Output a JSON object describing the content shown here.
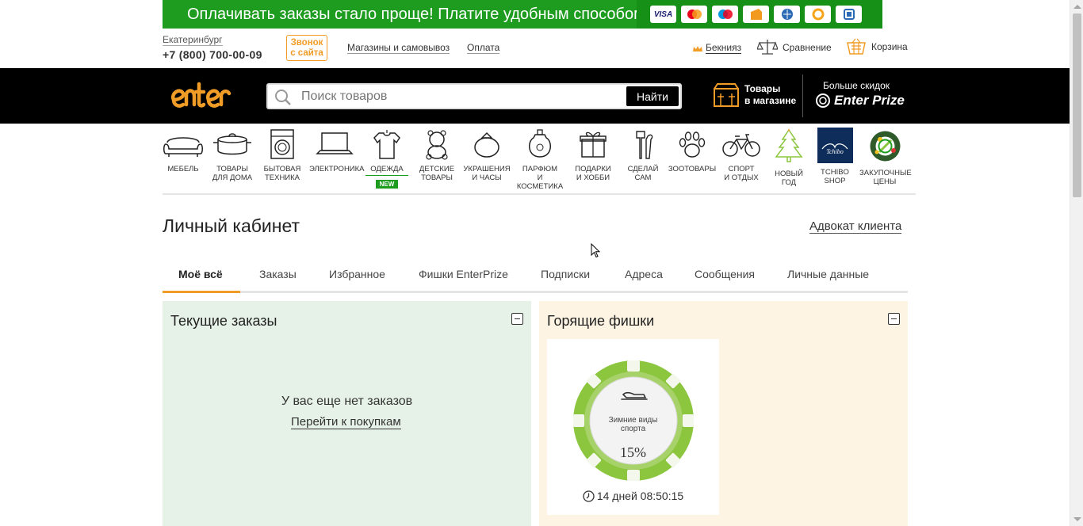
{
  "promo": {
    "text": "Оплачивать заказы стало проще! Платите удобным способом",
    "cards": [
      "VISA",
      "MasterCard",
      "Maestro",
      "Яндекс.Деньги",
      "WebMoney",
      "QIWI",
      "Платёжный терминал"
    ]
  },
  "topbar": {
    "city": "Екатеринбург",
    "phone": "+7 (800) 700-00-09",
    "callback_line1": "Звонок",
    "callback_line2": "с сайта",
    "stores_link": "Магазины и самовывоз",
    "payment_link": "Оплата",
    "user_name": "Бекнияз",
    "compare_label": "Сравнение",
    "cart_label": "Корзина"
  },
  "header": {
    "search_placeholder": "Поиск товаров",
    "search_button": "Найти",
    "store_line1": "Товары",
    "store_line2": "в магазине",
    "prize_top": "Больше скидок",
    "prize_name": "Enter Prize"
  },
  "categories": [
    {
      "line1": "Мебель",
      "line2": ""
    },
    {
      "line1": "Товары",
      "line2": "для дома"
    },
    {
      "line1": "Бытовая",
      "line2": "техника"
    },
    {
      "line1": "Электроника",
      "line2": ""
    },
    {
      "line1": "Одежда",
      "line2": "",
      "badge": "NEW"
    },
    {
      "line1": "Детские",
      "line2": "товары"
    },
    {
      "line1": "Украшения",
      "line2": "и часы"
    },
    {
      "line1": "Парфюм",
      "line2": "и косметика"
    },
    {
      "line1": "Подарки",
      "line2": "и хобби"
    },
    {
      "line1": "Сделай",
      "line2": "сам"
    },
    {
      "line1": "Зоотовары",
      "line2": ""
    },
    {
      "line1": "Спорт",
      "line2": "и отдых"
    },
    {
      "line1": "Новый",
      "line2": "год"
    },
    {
      "line1": "Tchibo",
      "line2": "shop"
    },
    {
      "line1": "Закупочные",
      "line2": "цены"
    }
  ],
  "page": {
    "title": "Личный кабинет",
    "advocate_link": "Адвокат клиента"
  },
  "tabs": [
    "Моё всё",
    "Заказы",
    "Избранное",
    "Фишки EnterPrize",
    "Подписки",
    "Адреса",
    "Сообщения",
    "Личные данные"
  ],
  "orders_panel": {
    "title": "Текущие заказы",
    "empty_text": "У вас еще нет заказов",
    "shop_link": "Перейти к покупкам"
  },
  "chips_panel": {
    "title": "Горящие фишки",
    "chip": {
      "title_line1": "Зимние виды",
      "title_line2": "спорта",
      "percent": "15%",
      "timer": "14 дней 08:50:15"
    }
  },
  "colors": {
    "promo_green": "#1e9c1f",
    "accent_orange": "#f19c26",
    "header_black": "#000000",
    "orders_bg": "#e6f2e7",
    "chips_bg": "#fdf4e3",
    "chip_green": "#8cc63f"
  }
}
